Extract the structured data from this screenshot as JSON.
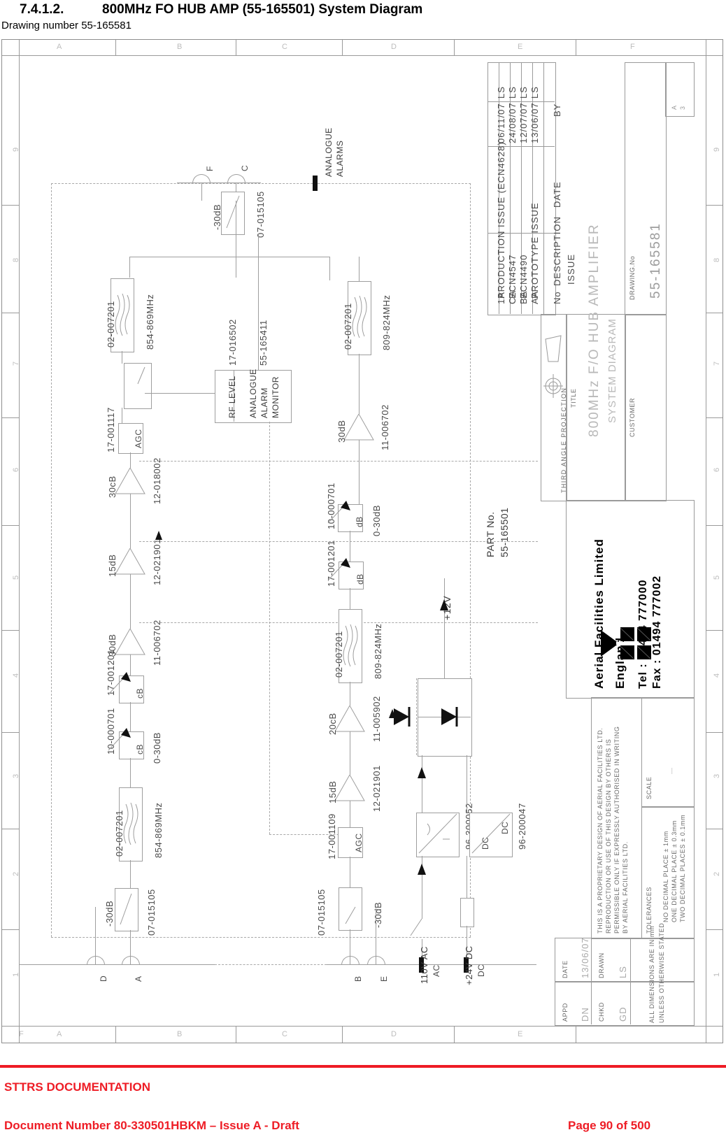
{
  "header": {
    "section_number": "7.4.1.2.",
    "section_title": "800MHz FO HUB AMP (55-165501) System Diagram",
    "drawing_line": "Drawing number 55-165581"
  },
  "footer": {
    "doc_type": "STTRS DOCUMENTATION",
    "document_number": "Document Number 80-330501HBKM – Issue A - Draft",
    "page": "Page 90 of 500",
    "rule_color": "#ee1c25"
  },
  "sheet": {
    "zones_top": [
      "A",
      "B",
      "C",
      "D",
      "E",
      "F"
    ],
    "zones_bottom": [
      "A",
      "B",
      "C",
      "D",
      "E",
      "F"
    ],
    "zones_left": [
      "9",
      "8",
      "7",
      "6",
      "5",
      "4",
      "3",
      "2",
      "1"
    ],
    "zones_right": [
      "9",
      "8",
      "7",
      "6",
      "5",
      "4",
      "3",
      "2",
      "1"
    ]
  },
  "diagram": {
    "analogue_alarms_label": "ANALOGUE\nALARMS",
    "analogue_alarms_line1": "ANALOGUE",
    "analogue_alarms_line2": "ALARMS",
    "part_no_label": "PART No.",
    "part_no_value": "55-165501",
    "ports": {
      "F": "F",
      "C": "C",
      "D": "D",
      "A": "A",
      "B": "B",
      "E": "E",
      "AC": "AC",
      "DC": "DC"
    },
    "power_labels": {
      "ac_input": "110V AC",
      "dc_input": "+24V DC",
      "rail": "+12V"
    },
    "psu": {
      "ac_dc_part": "96-300052",
      "dc_dc_part": "96-200047",
      "dc_dc_in": "DC",
      "dc_dc_out": "DC"
    },
    "alarm_monitor": {
      "left_cell": "RF LEVEL",
      "right_line1": "ANALOGUE",
      "right_line2": "ALARM",
      "right_line3": "MONITOR",
      "part_left": "17-016502",
      "part_right": "55-165411"
    },
    "components": [
      {
        "id": "att-top",
        "part": "07-015105",
        "value": "-30dB",
        "kind": "attenuator"
      },
      {
        "id": "filt-top",
        "part": "02-007201",
        "value": "854-869MHz",
        "kind": "filter"
      },
      {
        "id": "coupler-top",
        "part": "",
        "value": "",
        "kind": "coupler"
      },
      {
        "id": "agc-top",
        "part": "17-001117",
        "value": "AGC",
        "kind": "agc"
      },
      {
        "id": "amp-30cb",
        "part": "12-018002",
        "value": "30cB",
        "kind": "amplifier"
      },
      {
        "id": "amp-15db-a",
        "part": "12-021901",
        "value": "15dB",
        "kind": "amplifier"
      },
      {
        "id": "amp-30db-a",
        "part": "11-006702",
        "value": "30dB",
        "kind": "amplifier"
      },
      {
        "id": "atten-var-a",
        "part": "17-001201",
        "value": "cB",
        "kind": "variable-attenuator"
      },
      {
        "id": "atten-var-b",
        "part": "10-000701",
        "value": "cB",
        "range": "0-30dB",
        "kind": "variable-attenuator"
      },
      {
        "id": "filt-bot",
        "part": "02-007201",
        "value": "854-869MHz",
        "kind": "filter"
      },
      {
        "id": "att-bot",
        "part": "07-015105",
        "value": "-30dB",
        "kind": "attenuator"
      },
      {
        "id": "filt-r-top",
        "part": "02-007201",
        "value": "809-824MHz",
        "kind": "filter"
      },
      {
        "id": "amp-30db-r",
        "part": "11-006702",
        "value": "30dB",
        "kind": "amplifier"
      },
      {
        "id": "atten-r-a",
        "part": "10-000701",
        "value": "dB",
        "range": "0-30dB",
        "kind": "variable-attenuator"
      },
      {
        "id": "atten-r-b",
        "part": "17-001201",
        "value": "dB",
        "kind": "variable-attenuator"
      },
      {
        "id": "filt-r-bot",
        "part": "02-007201",
        "value": "809-824MHz",
        "kind": "filter"
      },
      {
        "id": "amp-20db-r",
        "part": "11-005902",
        "value": "20cB",
        "kind": "amplifier"
      },
      {
        "id": "amp-15db-r",
        "part": "12-021901",
        "value": "15dB",
        "kind": "amplifier"
      },
      {
        "id": "agc-r",
        "part": "17-001109",
        "value": "AGC",
        "kind": "agc"
      },
      {
        "id": "att-r-bot",
        "part": "07-015105",
        "value": "-30dB",
        "kind": "attenuator"
      }
    ]
  },
  "title_block": {
    "revision_header": {
      "no": "No",
      "description": "DESCRIPTION",
      "date": "DATE",
      "by": "BY"
    },
    "issue_label": "ISSUE",
    "revisions": [
      {
        "no": "1A",
        "description": "PRODUCTION ISSUE (ECN4628)",
        "date": "06/11/07",
        "by": "LS"
      },
      {
        "no": "CA",
        "description": "ECN4547",
        "date": "24/08/07",
        "by": "LS"
      },
      {
        "no": "BA",
        "description": "ECN4490",
        "date": "12/07/07",
        "by": "LS"
      },
      {
        "no": "AA",
        "description": "PROTOTYPE ISSUE",
        "date": "13/06/07",
        "by": "LS"
      }
    ],
    "projection_label": "THIRD ANGLE PROJECTION",
    "title_label": "TITLE",
    "title_line1": "800MHz F/O HUB AMPLIFIER",
    "title_line2": "SYSTEM DIAGRAM",
    "customer_label": "CUSTOMER",
    "customer_value": "",
    "drawing_no_label": "DRAWING.No",
    "drawing_no_value": "55-165581",
    "sheet_size_line1": "A",
    "sheet_size_line2": "3",
    "company": {
      "name": "Aerial Facilities Limited",
      "country": "England",
      "tel": "Tel : 01494 777000",
      "fax": "Fax : 01494 777002"
    },
    "proprietary_notice": [
      "THIS IS A PROPRIETARY DESIGN OF AERIAL FACILITIES LTD.",
      "REPRODUCTION OR USE OF THIS DESIGN BY OTHERS IS",
      "PERMISSIBLE ONLY IF EXPRESSLY AUTHORISED IN WRITING",
      "BY AERIAL FACILITIES LTD."
    ],
    "tolerances_label": "TOLERANCES",
    "tolerances": [
      "NO DECIMAL PLACE ± 1mm",
      "ONE DECIMAL PLACE ± 0.3mm",
      "TWO DECIMAL PLACES ± 0.1mm"
    ],
    "scale_label": "SCALE",
    "scale_value": "—",
    "dimensions_note_line1": "ALL DIMENSIONS ARE IN mm",
    "dimensions_note_line2": "UNLESS OTHERWISE STATED",
    "drawn_label": "DRAWN",
    "drawn_value": "LS",
    "chkd_label": "CHKD",
    "chkd_value": "GD",
    "date_label": "DATE",
    "date_value": "13/06/07",
    "appd_label": "APPD",
    "appd_value": "DN"
  }
}
